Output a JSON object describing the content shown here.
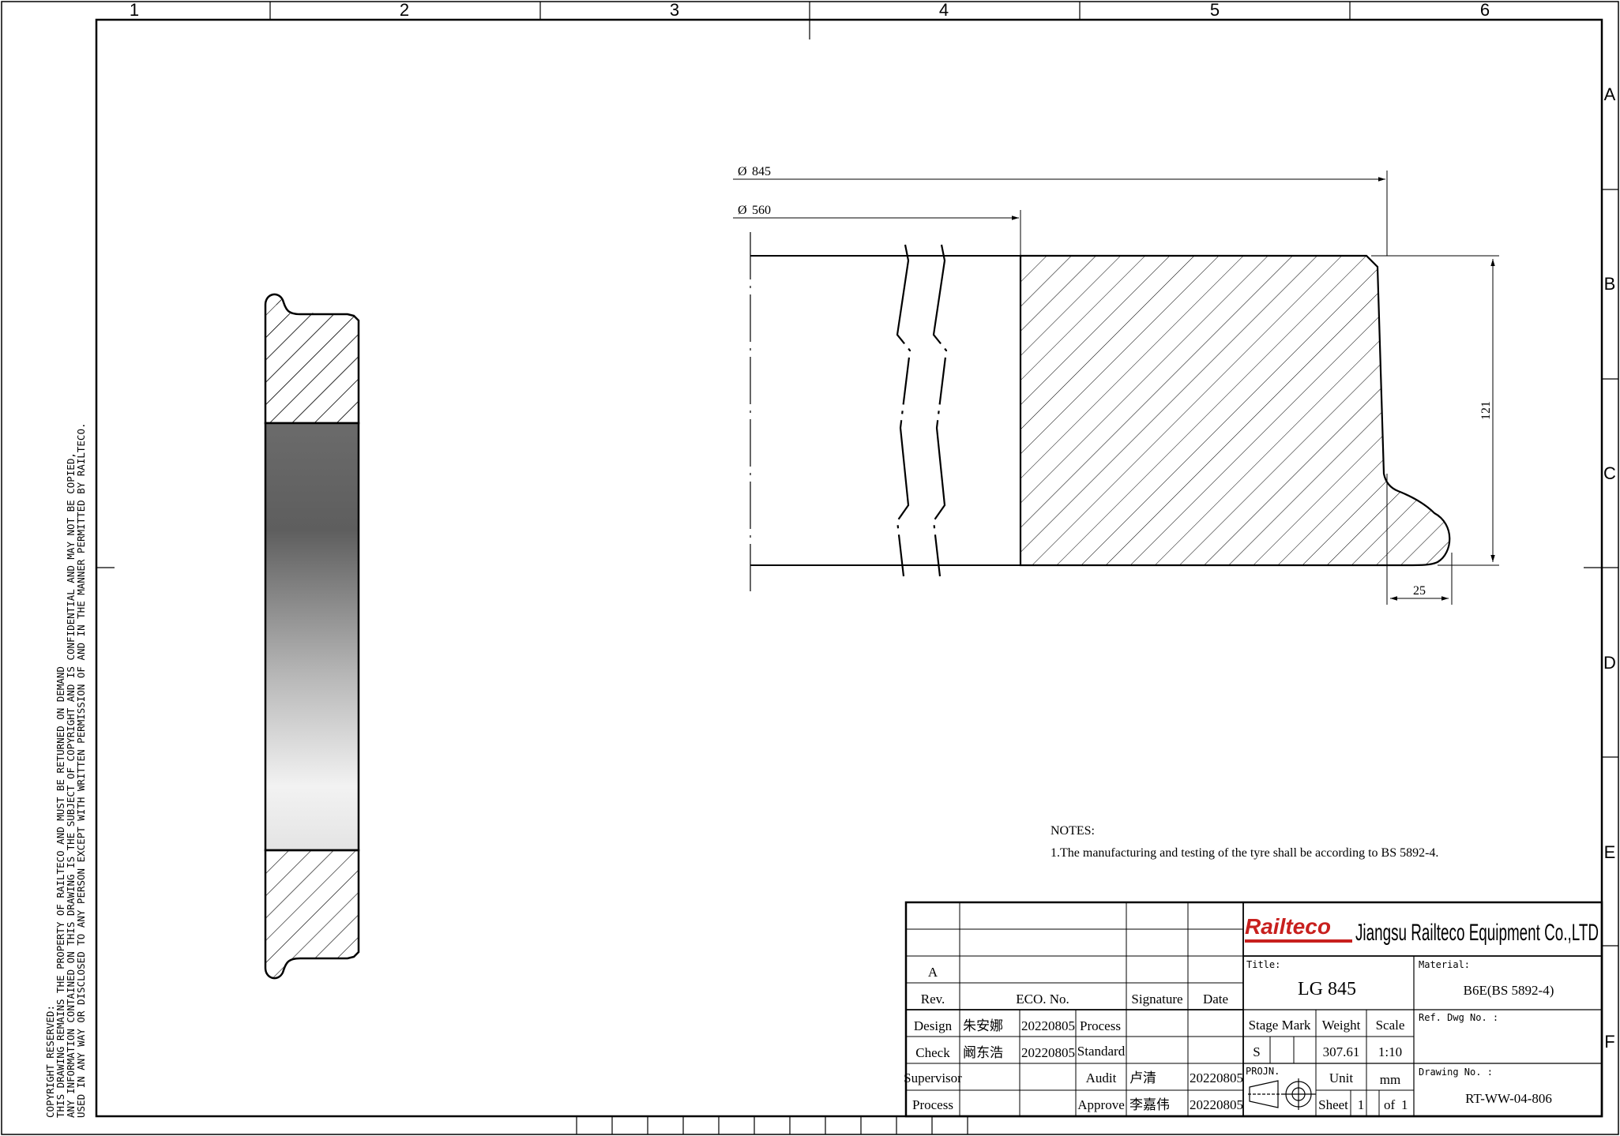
{
  "zones": {
    "columns": [
      "1",
      "2",
      "3",
      "4",
      "5",
      "6"
    ],
    "rows": [
      "A",
      "B",
      "C",
      "D",
      "E",
      "F"
    ]
  },
  "copyright": [
    "COPYRIGHT RESERVED:",
    "THIS DRAWING REMAINS THE PROPERTY OF RAILTECO AND MUST BE RETURNED ON DEMAND",
    "ANY INFORMATION CONTAINED ON THIS DRAWING IS THE SUBJECT OF COPYRIGHT AND IS CONFIDENTIAL AND MAY NOT BE COPIED,",
    "USED IN ANY WAY OR DISCLOSED TO ANY PERSON EXCEPT WITH WRITTEN PERMISSION OF AND IN THE MANNER PERMITTED BY RAILTECO."
  ],
  "dimensions": {
    "outer_diameter": "845",
    "inner_diameter": "560",
    "height": "121",
    "flange": "25",
    "diameter_symbol": "Ø"
  },
  "notes": {
    "heading": "NOTES:",
    "items": [
      "1.The manufacturing and testing of the tyre shall be according to BS 5892-4."
    ]
  },
  "title_block": {
    "logo_text": "Railteco",
    "company": "Jiangsu Railteco Equipment Co.,LTD",
    "rev_value": "A",
    "rev_label": "Rev.",
    "eco_label": "ECO. No.",
    "signature_label": "Signature",
    "date_label": "Date",
    "design_label": "Design",
    "design_name": "朱安娜",
    "design_date": "20220805",
    "process_label": "Process",
    "check_label": "Check",
    "check_name": "阚东浩",
    "check_date": "20220805",
    "standard_label": "Standard",
    "supervisor_label": "Supervisor",
    "audit_label": "Audit",
    "audit_name": "卢清",
    "audit_date": "20220805",
    "process2_label": "Process",
    "approve_label": "Approve",
    "approve_name": "李嘉伟",
    "approve_date": "20220805",
    "title_label": "Title:",
    "title_value": "LG 845",
    "material_label": "Material:",
    "material_value": "B6E(BS 5892-4)",
    "stage_mark_label": "Stage Mark",
    "weight_label": "Weight",
    "scale_label": "Scale",
    "stage_value": "S",
    "weight_value": "307.61",
    "scale_value": "1:10",
    "ref_label": "Ref. Dwg No. :",
    "projn_label": "PROJN.",
    "unit_label": "Unit",
    "unit_value": "mm",
    "sheet_label": "Sheet",
    "sheet_num": "1",
    "of_label": "of",
    "sheet_total": "1",
    "drawing_no_label": "Drawing No. :",
    "drawing_no_value": "RT-WW-04-806"
  },
  "colors": {
    "line": "#000000",
    "logo": "#c8201e",
    "logo_bar": "#c8201e"
  }
}
